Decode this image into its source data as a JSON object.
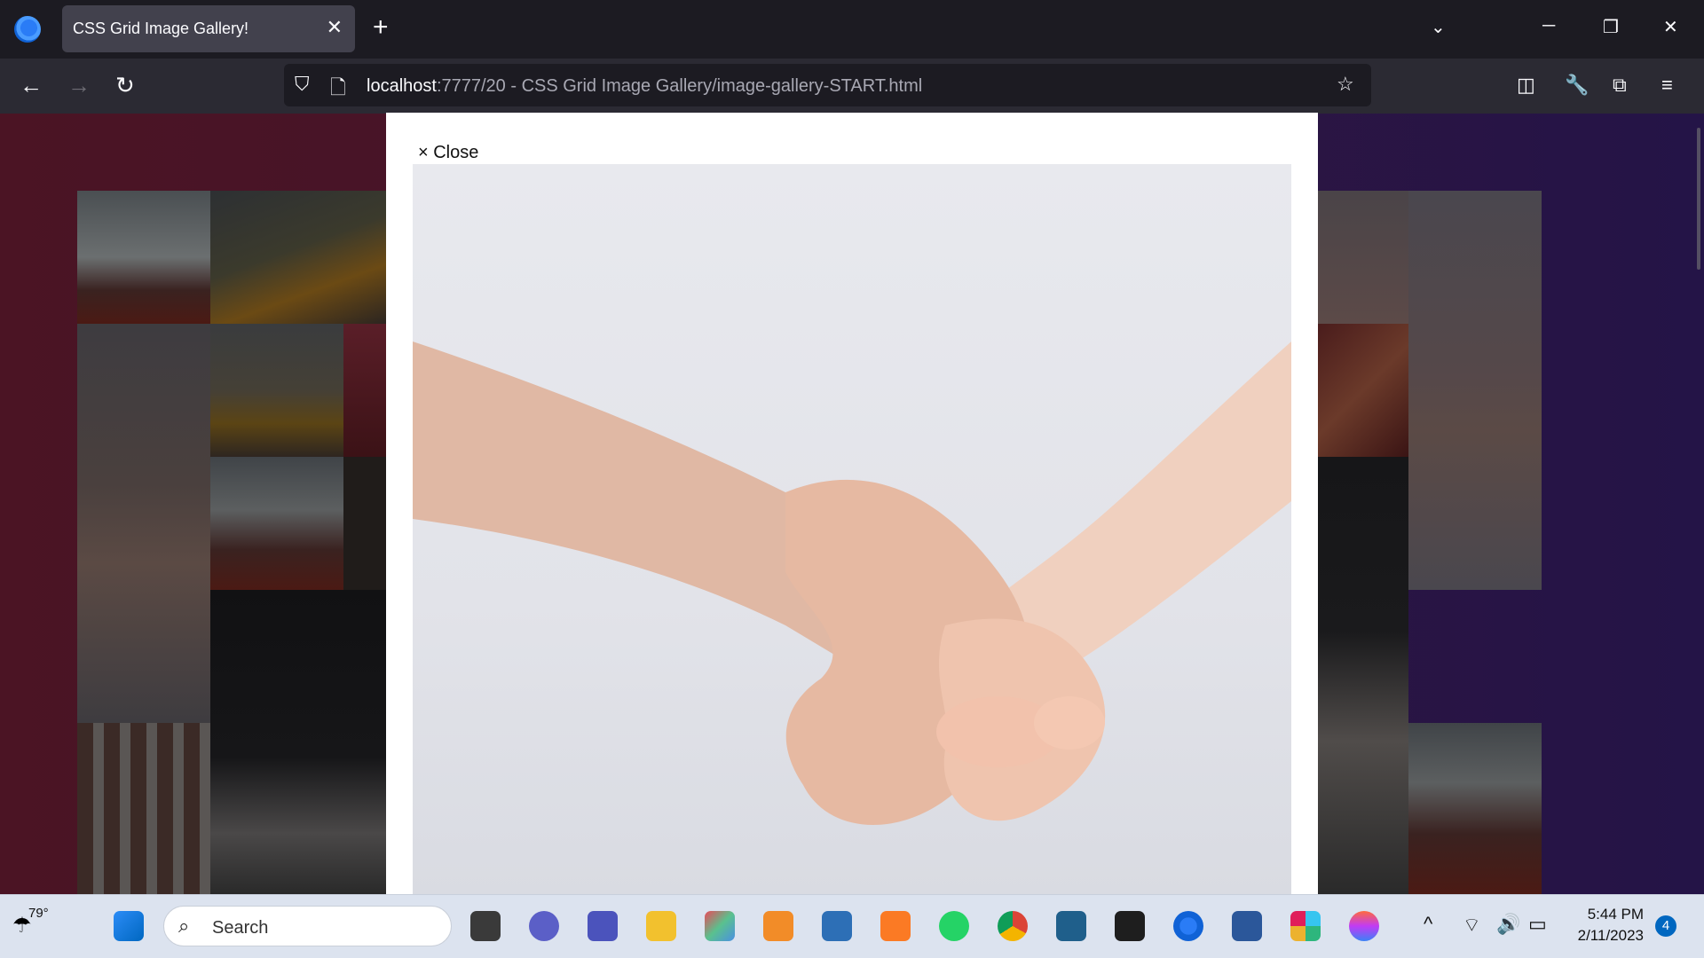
{
  "browser": {
    "tab_title": "CSS Grid Image Gallery!",
    "tab_close": "✕",
    "new_tab": "+",
    "url_host": "localhost",
    "url_rest": ":7777/20 - CSS Grid Image Gallery/image-gallery-START.html"
  },
  "modal": {
    "close_label": "× Close"
  },
  "taskbar": {
    "weather_temp": "79°",
    "search_placeholder": "Search",
    "time": "5:44 PM",
    "date": "2/11/2023",
    "notification_count": "4"
  },
  "colors": {
    "page_left": "#4b1424",
    "page_right": "#241447",
    "accent_blue": "#0067c0"
  }
}
